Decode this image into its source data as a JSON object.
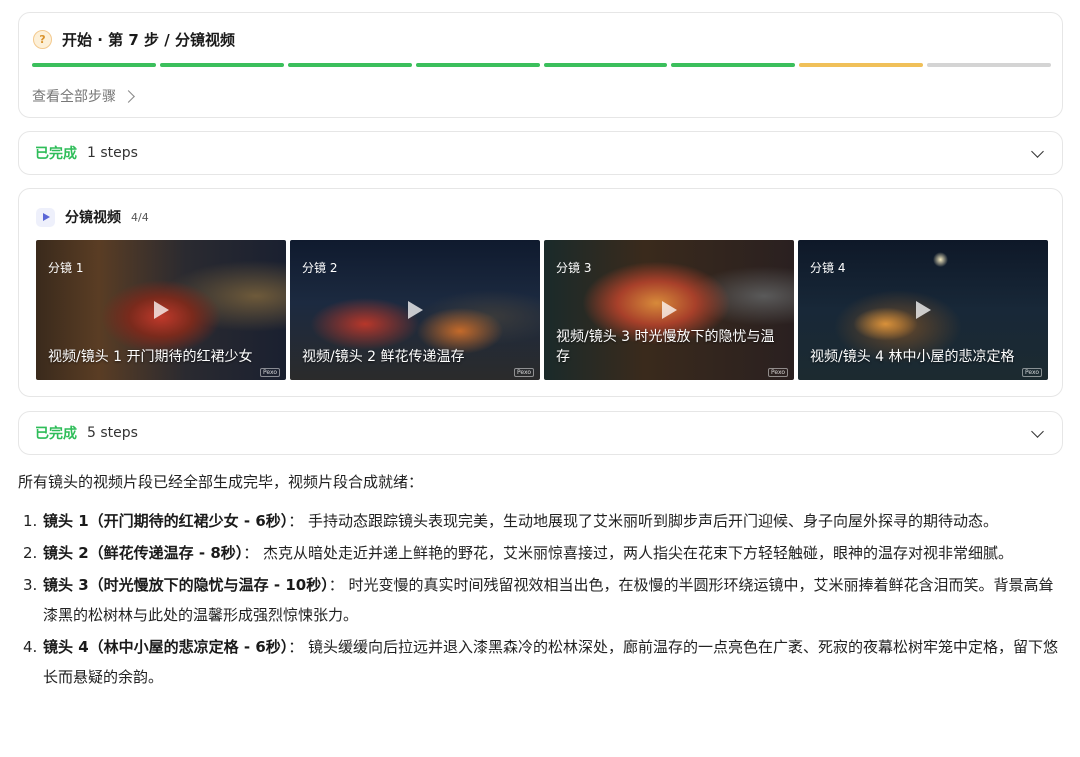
{
  "header": {
    "title": "开始 · 第 7 步 / 分镜视频",
    "view_all": "查看全部步骤",
    "progress_segments": [
      "#3bbf5c",
      "#3bbf5c",
      "#3bbf5c",
      "#3bbf5c",
      "#3bbf5c",
      "#3bbf5c",
      "#f0c059",
      "#d4d4d4"
    ]
  },
  "done_section_1": {
    "status": "已完成",
    "count": "1 steps"
  },
  "videos": {
    "title": "分镜视频",
    "counter": "4/4",
    "items": [
      {
        "label": "分镜 1",
        "caption": "视频/镜头 1 开门期待的红裙少女",
        "watermark": "Pexo"
      },
      {
        "label": "分镜 2",
        "caption": "视频/镜头 2 鲜花传递温存",
        "watermark": "Pexo"
      },
      {
        "label": "分镜 3",
        "caption": "视频/镜头 3 时光慢放下的隐忧与温存",
        "watermark": "Pexo"
      },
      {
        "label": "分镜 4",
        "caption": "视频/镜头 4 林中小屋的悲凉定格",
        "watermark": "Pexo"
      }
    ]
  },
  "done_section_2": {
    "status": "已完成",
    "count": "5 steps"
  },
  "summary": {
    "intro": "所有镜头的视频片段已经全部生成完毕，视频片段合成就绪：",
    "items": [
      {
        "num": "1.",
        "head": "镜头 1（开门期待的红裙少女 - 6秒）",
        "body": "： 手持动态跟踪镜头表现完美，生动地展现了艾米丽听到脚步声后开门迎候、身子向屋外探寻的期待动态。"
      },
      {
        "num": "2.",
        "head": "镜头 2（鲜花传递温存 - 8秒）",
        "body": "： 杰克从暗处走近并递上鲜艳的野花，艾米丽惊喜接过，两人指尖在花束下方轻轻触碰，眼神的温存对视非常细腻。"
      },
      {
        "num": "3.",
        "head": "镜头 3（时光慢放下的隐忧与温存 - 10秒）",
        "body": "： 时光变慢的真实时间残留视效相当出色，在极慢的半圆形环绕运镜中，艾米丽捧着鲜花含泪而笑。背景高耸漆黑的松树林与此处的温馨形成强烈惊悚张力。"
      },
      {
        "num": "4.",
        "head": "镜头 4（林中小屋的悲凉定格 - 6秒）",
        "body": "： 镜头缓缓向后拉远并退入漆黑森冷的松林深处，廊前温存的一点亮色在广袤、死寂的夜幕松树牢笼中定格，留下悠长而悬疑的余韵。"
      }
    ]
  }
}
